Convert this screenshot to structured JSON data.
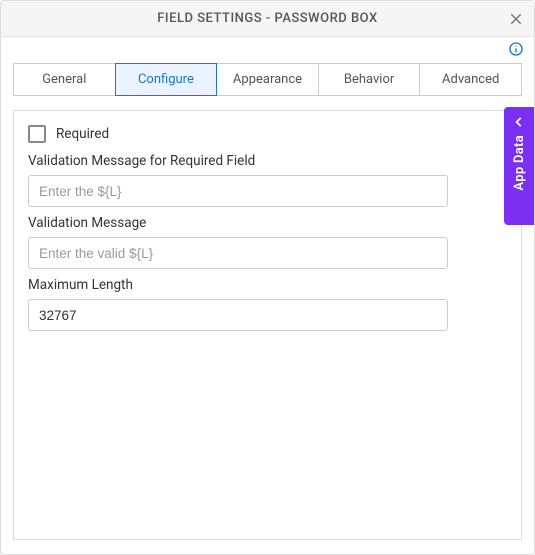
{
  "titlebar": {
    "title": "FIELD SETTINGS - PASSWORD BOX"
  },
  "tabs": [
    {
      "label": "General"
    },
    {
      "label": "Configure"
    },
    {
      "label": "Appearance"
    },
    {
      "label": "Behavior"
    },
    {
      "label": "Advanced"
    }
  ],
  "active_tab_index": 1,
  "form": {
    "required_label": "Required",
    "required_checked": false,
    "validation_required_label": "Validation Message for Required Field",
    "validation_required_placeholder": "Enter the ${L}",
    "validation_required_value": "",
    "validation_msg_label": "Validation Message",
    "validation_msg_placeholder": "Enter the valid ${L}",
    "validation_msg_value": "",
    "max_length_label": "Maximum Length",
    "max_length_value": "32767"
  },
  "side_drawer": {
    "label": "App Data"
  }
}
